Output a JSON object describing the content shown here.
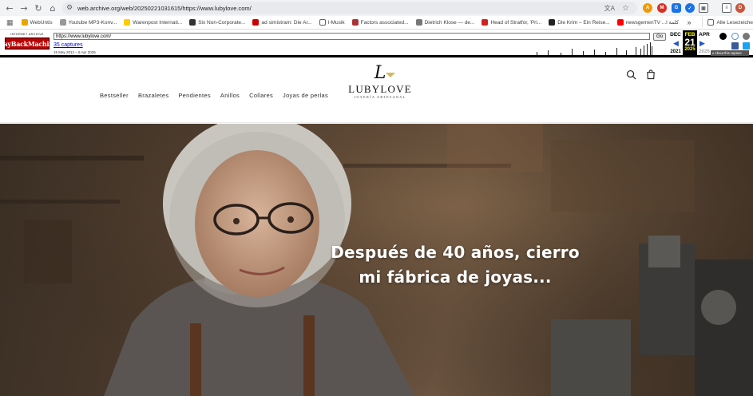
{
  "browser": {
    "url": "web.archive.org/web/20250221031615/https://www.lubylove.com/",
    "bookmarks": [
      {
        "label": "WebUntis",
        "color": "#e8a500"
      },
      {
        "label": "Youtube MP3-Konv...",
        "color": "#999999"
      },
      {
        "label": "Warenpost Internati...",
        "color": "#ffcc00"
      },
      {
        "label": "Six Non-Corporate...",
        "color": "#333333"
      },
      {
        "label": "ad simistram: Die Ar...",
        "color": "#cc0000"
      },
      {
        "label": "I-Musik",
        "color": "#5f6368"
      },
      {
        "label": "Factors associated...",
        "color": "#aa3333"
      },
      {
        "label": "Dietrich Klose — de...",
        "color": "#777777"
      },
      {
        "label": "Head of Stratfor, 'Pri...",
        "color": "#cc2222"
      },
      {
        "label": "Die Krim – Ein Reise...",
        "color": "#222222"
      },
      {
        "label": "newsgemenTV ...l كلمة",
        "color": "#ff0000"
      }
    ],
    "bookmarks_more": "»",
    "all_bookmarks": "Alle Lesezeiche"
  },
  "wayback": {
    "logo_small": "INTERNET ARCHIVE",
    "logo_big": "WayBackMachine",
    "url_input": "https://www.lubylove.com/",
    "go_label": "Go",
    "captures": "35 captures",
    "range": "15 May 2012 – 8 Apr 2025",
    "prev_month": "DEC",
    "cur_month": "FEB",
    "next_month": "APR",
    "cur_day": "21",
    "prev_year": "2021",
    "cur_year": "2025",
    "next_year": "2026",
    "about": "▾ About this capture"
  },
  "site": {
    "logo_mark": "L",
    "brand": "LUBYLOVE",
    "tagline": "JOYERÍA ARTESANAL",
    "menu": [
      "Bestseller",
      "Brazaletes",
      "Pendientes",
      "Anillos",
      "Collares",
      "Joyas de perlas"
    ],
    "hero_line1": "Después de 40 años, cierro",
    "hero_line2": "mi fábrica de joyas..."
  }
}
